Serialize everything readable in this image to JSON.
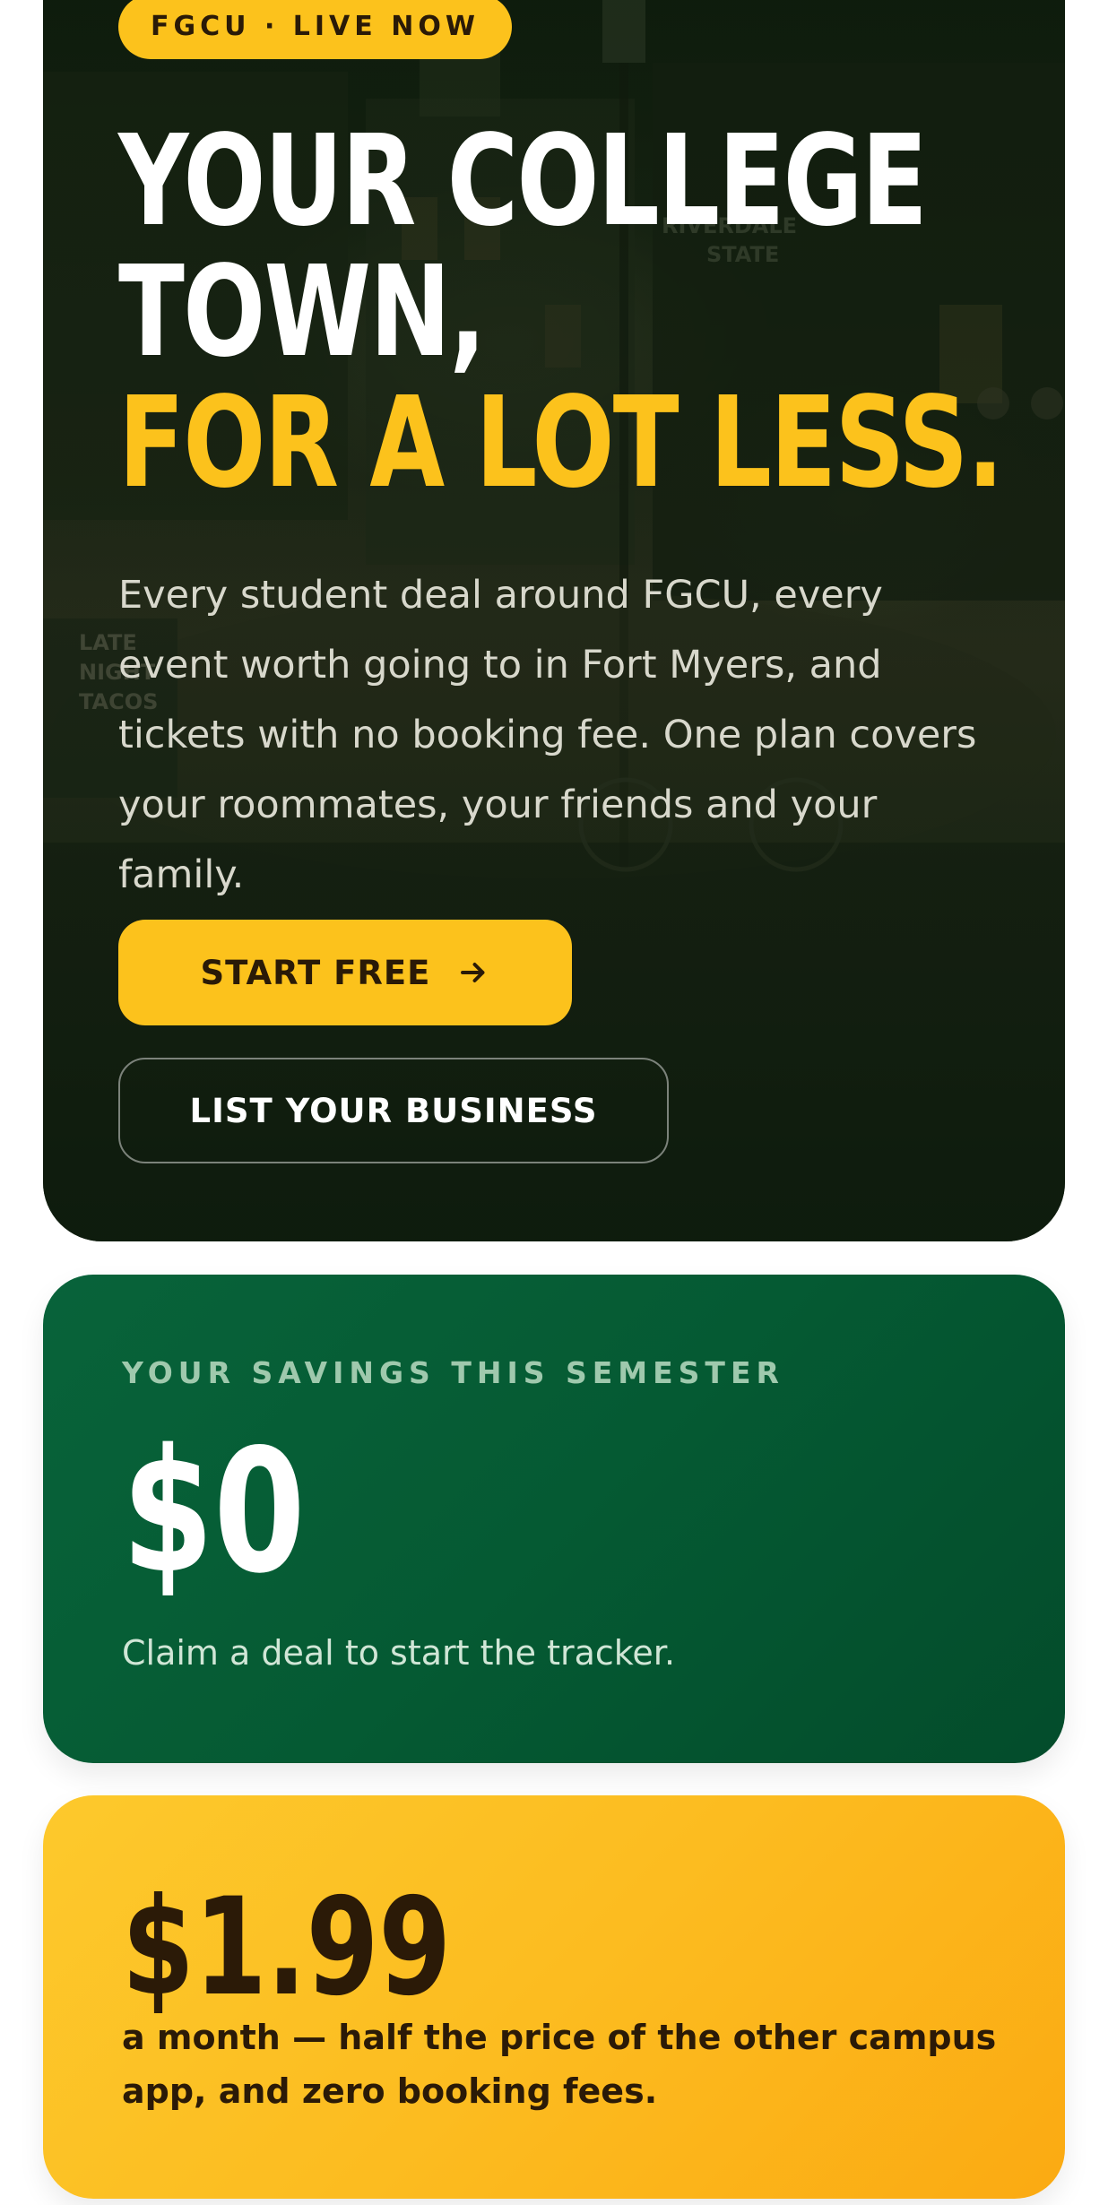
{
  "hero": {
    "badge": "FGCU · LIVE NOW",
    "headline_line1": "YOUR COLLEGE",
    "headline_line2": "TOWN,",
    "headline_line3": "FOR A LOT LESS.",
    "body": "Every student deal around FGCU, every event worth going to in Fort Myers, and tickets with no booking fee. One plan covers your roommates, your friends and your family.",
    "primary_cta": "START FREE",
    "primary_cta_icon": "arrow-right-icon",
    "secondary_cta": "LIST YOUR BUSINESS",
    "background_signs": [
      "LATE NIGHT TACOS",
      "RIVERDALE STATE"
    ]
  },
  "savings": {
    "label": "YOUR SAVINGS THIS SEMESTER",
    "amount": "$0",
    "note": "Claim a deal to start the tracker."
  },
  "pricing": {
    "amount": "$1.99",
    "note": "a month — half the price of the other campus app, and zero booking fees."
  },
  "colors": {
    "accent_yellow": "#fcc21c",
    "brand_green": "#055a33",
    "dark_text": "#2b1a07"
  }
}
